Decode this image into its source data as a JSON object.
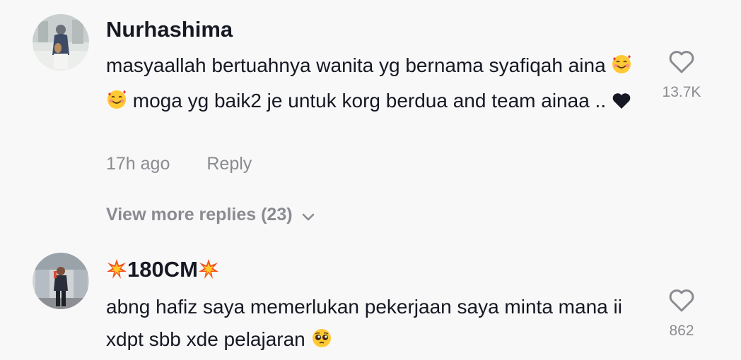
{
  "comments": [
    {
      "username": "Nurhashima",
      "text_parts": [
        "masyaallah bertuahnya wanita yg bernama syafiqah aina ",
        " moga yg baik2 je untuk korg berdua and team ainaa .. "
      ],
      "emoji": [
        "smiling-face-with-hearts",
        "smiling-face-with-hearts",
        "heart"
      ],
      "time": "17h ago",
      "reply_label": "Reply",
      "view_more_label": "View more replies (23)",
      "like_count": "13.7K"
    },
    {
      "username": "180CM",
      "username_emoji": [
        "collision",
        "collision"
      ],
      "text": "abng hafiz saya memerlukan pekerjaan saya minta mana ii xdpt sbb xde pelajaran ",
      "emoji": [
        "pleading-face"
      ],
      "like_count": "862"
    }
  ],
  "colors": {
    "background": "#f8f8f8",
    "primary_text": "#161823",
    "secondary_text": "#8a8b91"
  }
}
